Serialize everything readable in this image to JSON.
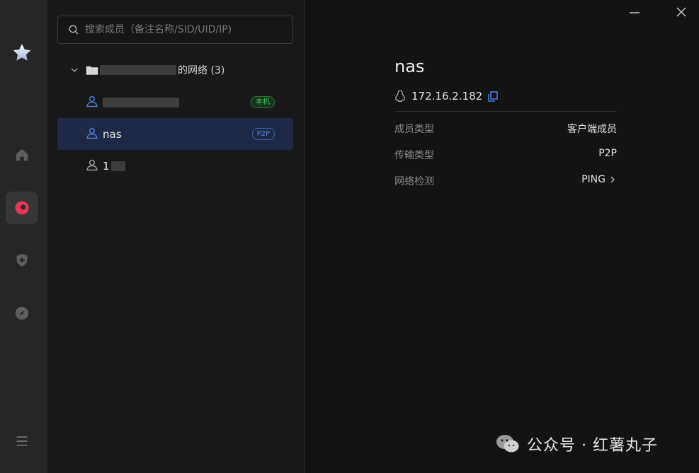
{
  "search": {
    "placeholder": "搜索成员（备注名称/SID/UID/IP)"
  },
  "group": {
    "title_suffix": "的网络 (3)"
  },
  "members": [
    {
      "name": "",
      "tag": "本机"
    },
    {
      "name": "nas",
      "tag": "P2P"
    },
    {
      "name": "1"
    }
  ],
  "detail": {
    "name": "nas",
    "ip": "172.16.2.182",
    "rows": [
      {
        "key": "成员类型",
        "value": "客户端成员"
      },
      {
        "key": "传输类型",
        "value": "P2P"
      },
      {
        "key": "网络检测",
        "value": "PING"
      }
    ]
  },
  "watermark": {
    "text": "公众号 · 红薯丸子"
  },
  "colors": {
    "accent": "#5a7ed8",
    "active_nav": "#e8385a",
    "selected_row": "#1e2a45",
    "local_tag": "#3dc45a"
  },
  "icons": [
    "star-icon",
    "home-icon",
    "network-icon",
    "shield-plus-icon",
    "compass-icon",
    "menu-icon",
    "search-icon",
    "chevron-down-icon",
    "folder-icon",
    "user-icon",
    "linux-icon",
    "copy-icon",
    "chevron-right-icon",
    "minimize-icon",
    "close-icon",
    "wechat-icon"
  ]
}
